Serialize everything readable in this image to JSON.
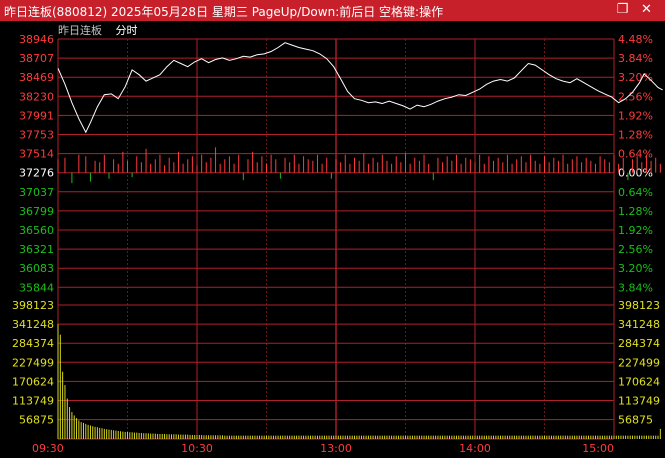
{
  "window": {
    "title": "昨日连板(880812)  2025年05月28日 星期三 PageUp/Down:前后日 空格键:操作",
    "restore_icon": "restore-window-icon",
    "close_icon": "close-icon"
  },
  "subheader": {
    "label": "昨日连板",
    "tab": "分时"
  },
  "chart_data": {
    "type": "line",
    "price_axis": {
      "ticks": [
        "38946",
        "38707",
        "38469",
        "38230",
        "37991",
        "37753",
        "37514",
        "37276",
        "37037",
        "36799",
        "36560",
        "36321",
        "36083",
        "35844"
      ],
      "pct_ticks": [
        "4.48%",
        "3.84%",
        "3.20%",
        "2.56%",
        "1.92%",
        "1.28%",
        "0.64%",
        "0.00%",
        "0.64%",
        "1.28%",
        "1.92%",
        "2.56%",
        "3.20%",
        "3.84%"
      ],
      "ylim": [
        35844,
        38946
      ],
      "prev_close": 37276
    },
    "volume_axis": {
      "ticks": [
        "398123",
        "341248",
        "284374",
        "227499",
        "170624",
        "113749",
        "56875"
      ],
      "ylim": [
        0,
        398123
      ]
    },
    "time_labels": [
      "09:30",
      "10:30",
      "13:00",
      "14:00",
      "15:00"
    ],
    "price_series": [
      [
        0,
        38580
      ],
      [
        3,
        38380
      ],
      [
        6,
        38150
      ],
      [
        9,
        37950
      ],
      [
        12,
        37780
      ],
      [
        14,
        37900
      ],
      [
        17,
        38100
      ],
      [
        20,
        38250
      ],
      [
        23,
        38260
      ],
      [
        26,
        38200
      ],
      [
        29,
        38350
      ],
      [
        32,
        38560
      ],
      [
        35,
        38500
      ],
      [
        38,
        38420
      ],
      [
        41,
        38460
      ],
      [
        44,
        38500
      ],
      [
        47,
        38600
      ],
      [
        50,
        38680
      ],
      [
        53,
        38640
      ],
      [
        56,
        38600
      ],
      [
        59,
        38660
      ],
      [
        62,
        38700
      ],
      [
        65,
        38650
      ],
      [
        68,
        38690
      ],
      [
        71,
        38710
      ],
      [
        74,
        38680
      ],
      [
        77,
        38700
      ],
      [
        80,
        38730
      ],
      [
        83,
        38720
      ],
      [
        86,
        38750
      ],
      [
        89,
        38760
      ],
      [
        92,
        38790
      ],
      [
        95,
        38840
      ],
      [
        98,
        38900
      ],
      [
        101,
        38870
      ],
      [
        104,
        38840
      ],
      [
        107,
        38820
      ],
      [
        110,
        38800
      ],
      [
        113,
        38760
      ],
      [
        116,
        38700
      ],
      [
        119,
        38600
      ],
      [
        122,
        38450
      ],
      [
        125,
        38290
      ],
      [
        128,
        38200
      ],
      [
        131,
        38180
      ],
      [
        134,
        38150
      ],
      [
        137,
        38160
      ],
      [
        140,
        38140
      ],
      [
        143,
        38170
      ],
      [
        146,
        38140
      ],
      [
        149,
        38110
      ],
      [
        152,
        38070
      ],
      [
        155,
        38120
      ],
      [
        158,
        38100
      ],
      [
        161,
        38130
      ],
      [
        164,
        38170
      ],
      [
        167,
        38200
      ],
      [
        170,
        38220
      ],
      [
        173,
        38250
      ],
      [
        176,
        38240
      ],
      [
        179,
        38280
      ],
      [
        182,
        38320
      ],
      [
        185,
        38380
      ],
      [
        188,
        38420
      ],
      [
        191,
        38440
      ],
      [
        194,
        38420
      ],
      [
        197,
        38460
      ],
      [
        200,
        38550
      ],
      [
        203,
        38640
      ],
      [
        206,
        38620
      ],
      [
        209,
        38560
      ],
      [
        212,
        38500
      ],
      [
        215,
        38450
      ],
      [
        218,
        38420
      ],
      [
        221,
        38400
      ],
      [
        224,
        38450
      ],
      [
        227,
        38400
      ],
      [
        230,
        38350
      ],
      [
        233,
        38300
      ],
      [
        236,
        38260
      ],
      [
        239,
        38220
      ],
      [
        242,
        38150
      ],
      [
        245,
        38200
      ],
      [
        248,
        38280
      ],
      [
        251,
        38400
      ],
      [
        253,
        38510
      ],
      [
        256,
        38430
      ],
      [
        259,
        38340
      ],
      [
        261,
        38310
      ]
    ],
    "volume_series": [
      341248,
      310000,
      200000,
      160000,
      120000,
      95000,
      80000,
      70000,
      62000,
      55000,
      50000,
      48000,
      45000,
      42000,
      40000,
      38000,
      36000,
      35000,
      33000,
      32000,
      30000,
      29000,
      28000,
      27000,
      26000,
      25000,
      24000,
      23000,
      22000,
      21000,
      21000,
      20000,
      20000,
      19000,
      19000,
      18000,
      18000,
      17000,
      17000,
      17000,
      16000,
      16000,
      16000,
      15000,
      15000,
      15000,
      15000,
      14000,
      14000,
      14000,
      14000,
      14000,
      13000,
      13000,
      13000,
      13000,
      13000,
      12000,
      12000,
      12000,
      12000,
      12000,
      12000,
      11000,
      11000,
      11000,
      11000,
      11000,
      11000,
      11000,
      11000,
      11000,
      10000,
      10000,
      10000,
      10000,
      10000,
      10000,
      10000,
      10000,
      10000,
      10000,
      10000,
      10000,
      10000,
      10000,
      10000,
      10000,
      10000,
      10000,
      10000,
      10000,
      10000,
      10000,
      10000,
      10000,
      10000,
      10000,
      10000,
      10000,
      10000,
      10000,
      10000,
      10000,
      10000,
      10000,
      10000,
      10000,
      10000,
      10000,
      10000,
      10000,
      10000,
      10000,
      10000,
      10000,
      10000,
      10000,
      10000,
      10000,
      10000,
      10000,
      10000,
      10000,
      10000,
      10000,
      10000,
      10000,
      10000,
      10000,
      10000,
      10000,
      10000,
      10000,
      10000,
      10000,
      10000,
      10000,
      10000,
      10000,
      10000,
      10000,
      10000,
      10000,
      10000,
      10000,
      10000,
      10000,
      10000,
      10000,
      10000,
      10000,
      10000,
      10000,
      10000,
      10000,
      10000,
      10000,
      10000,
      10000,
      10000,
      10000,
      10000,
      10000,
      10000,
      10000,
      10000,
      10000,
      10000,
      10000,
      10000,
      10000,
      10000,
      10000,
      10000,
      10000,
      10000,
      10000,
      10000,
      10000,
      10000,
      10000,
      10000,
      10000,
      10000,
      10000,
      10000,
      10000,
      10000,
      10000,
      10000,
      10000,
      10000,
      10000,
      10000,
      10000,
      10000,
      10000,
      10000,
      10000,
      10000,
      10000,
      10000,
      10000,
      10000,
      10000,
      10000,
      10000,
      10000,
      10000,
      10000,
      10000,
      10000,
      10000,
      10000,
      10000,
      10000,
      10000,
      10000,
      10000,
      10000,
      10000,
      10000,
      10000,
      10000,
      10000,
      10000,
      10000,
      10000,
      10000,
      10000,
      10000,
      10000,
      10000,
      10000,
      10000,
      10000,
      10000,
      10000,
      10000,
      10000,
      10000,
      10000,
      10000,
      10000,
      10000,
      10000,
      10000,
      10000,
      10000,
      10000,
      10000,
      10000,
      10000,
      10000,
      10000,
      10000,
      10000,
      10000,
      10000,
      30000
    ],
    "bar_series": [
      [
        0,
        0.45
      ],
      [
        3,
        0.5
      ],
      [
        6,
        -0.35
      ],
      [
        9,
        0.6
      ],
      [
        12,
        0.55
      ],
      [
        14,
        -0.3
      ],
      [
        16,
        0.4
      ],
      [
        18,
        0.35
      ],
      [
        20,
        0.6
      ],
      [
        22,
        -0.2
      ],
      [
        24,
        0.45
      ],
      [
        26,
        0.3
      ],
      [
        28,
        0.7
      ],
      [
        30,
        0.4
      ],
      [
        32,
        -0.15
      ],
      [
        34,
        0.55
      ],
      [
        36,
        0.35
      ],
      [
        38,
        0.8
      ],
      [
        40,
        0.3
      ],
      [
        42,
        0.45
      ],
      [
        44,
        0.6
      ],
      [
        46,
        0.25
      ],
      [
        48,
        0.5
      ],
      [
        50,
        0.35
      ],
      [
        52,
        0.7
      ],
      [
        54,
        0.3
      ],
      [
        56,
        0.45
      ],
      [
        58,
        0.55
      ],
      [
        60,
        0.25
      ],
      [
        62,
        0.6
      ],
      [
        64,
        0.35
      ],
      [
        66,
        0.5
      ],
      [
        68,
        0.85
      ],
      [
        70,
        0.3
      ],
      [
        72,
        0.45
      ],
      [
        74,
        0.55
      ],
      [
        76,
        0.3
      ],
      [
        78,
        0.6
      ],
      [
        80,
        -0.25
      ],
      [
        82,
        0.45
      ],
      [
        84,
        0.7
      ],
      [
        86,
        0.35
      ],
      [
        88,
        0.55
      ],
      [
        90,
        0.3
      ],
      [
        92,
        0.6
      ],
      [
        94,
        0.45
      ],
      [
        96,
        -0.2
      ],
      [
        98,
        0.5
      ],
      [
        100,
        0.35
      ],
      [
        102,
        0.6
      ],
      [
        104,
        0.3
      ],
      [
        106,
        0.55
      ],
      [
        108,
        0.45
      ],
      [
        110,
        0.4
      ],
      [
        112,
        0.6
      ],
      [
        114,
        0.3
      ],
      [
        116,
        0.5
      ],
      [
        118,
        -0.2
      ],
      [
        120,
        0.45
      ],
      [
        122,
        0.35
      ],
      [
        124,
        0.6
      ],
      [
        126,
        0.3
      ],
      [
        128,
        0.5
      ],
      [
        130,
        0.4
      ],
      [
        132,
        0.65
      ],
      [
        134,
        0.3
      ],
      [
        136,
        0.5
      ],
      [
        138,
        0.35
      ],
      [
        140,
        0.6
      ],
      [
        142,
        0.4
      ],
      [
        144,
        0.3
      ],
      [
        146,
        0.55
      ],
      [
        148,
        0.35
      ],
      [
        150,
        0.65
      ],
      [
        152,
        0.3
      ],
      [
        154,
        0.5
      ],
      [
        156,
        0.4
      ],
      [
        158,
        0.6
      ],
      [
        160,
        0.3
      ],
      [
        162,
        -0.25
      ],
      [
        164,
        0.5
      ],
      [
        166,
        0.35
      ],
      [
        168,
        0.55
      ],
      [
        170,
        0.4
      ],
      [
        172,
        0.6
      ],
      [
        174,
        0.3
      ],
      [
        176,
        0.5
      ],
      [
        178,
        0.45
      ],
      [
        180,
        0.35
      ],
      [
        182,
        0.6
      ],
      [
        184,
        0.3
      ],
      [
        186,
        0.55
      ],
      [
        188,
        0.4
      ],
      [
        190,
        0.5
      ],
      [
        192,
        0.35
      ],
      [
        194,
        0.6
      ],
      [
        196,
        0.3
      ],
      [
        198,
        0.45
      ],
      [
        200,
        0.55
      ],
      [
        202,
        0.35
      ],
      [
        204,
        0.6
      ],
      [
        206,
        0.4
      ],
      [
        208,
        0.3
      ],
      [
        210,
        0.55
      ],
      [
        212,
        0.35
      ],
      [
        214,
        0.5
      ],
      [
        216,
        0.4
      ],
      [
        218,
        0.6
      ],
      [
        220,
        0.3
      ],
      [
        222,
        0.45
      ],
      [
        224,
        0.55
      ],
      [
        226,
        0.35
      ],
      [
        228,
        0.5
      ],
      [
        230,
        0.4
      ],
      [
        232,
        0.3
      ],
      [
        234,
        0.55
      ],
      [
        236,
        0.45
      ],
      [
        238,
        0.35
      ],
      [
        240,
        0.6
      ],
      [
        242,
        0.3
      ],
      [
        244,
        0.5
      ],
      [
        246,
        -0.25
      ],
      [
        248,
        0.45
      ],
      [
        250,
        0.55
      ],
      [
        252,
        0.35
      ],
      [
        254,
        0.6
      ],
      [
        256,
        0.4
      ],
      [
        258,
        0.5
      ],
      [
        260,
        0.3
      ]
    ]
  },
  "colors": {
    "background": "#000000",
    "grid": "#b0202a",
    "price_line": "#ffffff",
    "up": "#ff3b3b",
    "down": "#19c019",
    "volume": "#d8d820",
    "tick_up": "#ff3b3b",
    "tick_down": "#19c019",
    "tick_zero": "#ffffff",
    "tick_volume": "#e0e020",
    "time_label": "#ff3b3b"
  }
}
